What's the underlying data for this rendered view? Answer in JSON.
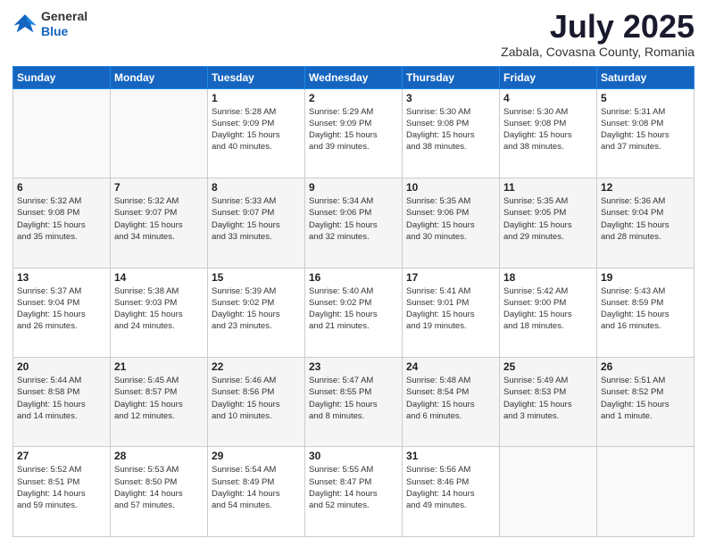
{
  "header": {
    "logo_general": "General",
    "logo_blue": "Blue",
    "month_title": "July 2025",
    "location": "Zabala, Covasna County, Romania"
  },
  "days_of_week": [
    "Sunday",
    "Monday",
    "Tuesday",
    "Wednesday",
    "Thursday",
    "Friday",
    "Saturday"
  ],
  "weeks": [
    [
      {
        "day": "",
        "info": ""
      },
      {
        "day": "",
        "info": ""
      },
      {
        "day": "1",
        "info": "Sunrise: 5:28 AM\nSunset: 9:09 PM\nDaylight: 15 hours\nand 40 minutes."
      },
      {
        "day": "2",
        "info": "Sunrise: 5:29 AM\nSunset: 9:09 PM\nDaylight: 15 hours\nand 39 minutes."
      },
      {
        "day": "3",
        "info": "Sunrise: 5:30 AM\nSunset: 9:08 PM\nDaylight: 15 hours\nand 38 minutes."
      },
      {
        "day": "4",
        "info": "Sunrise: 5:30 AM\nSunset: 9:08 PM\nDaylight: 15 hours\nand 38 minutes."
      },
      {
        "day": "5",
        "info": "Sunrise: 5:31 AM\nSunset: 9:08 PM\nDaylight: 15 hours\nand 37 minutes."
      }
    ],
    [
      {
        "day": "6",
        "info": "Sunrise: 5:32 AM\nSunset: 9:08 PM\nDaylight: 15 hours\nand 35 minutes."
      },
      {
        "day": "7",
        "info": "Sunrise: 5:32 AM\nSunset: 9:07 PM\nDaylight: 15 hours\nand 34 minutes."
      },
      {
        "day": "8",
        "info": "Sunrise: 5:33 AM\nSunset: 9:07 PM\nDaylight: 15 hours\nand 33 minutes."
      },
      {
        "day": "9",
        "info": "Sunrise: 5:34 AM\nSunset: 9:06 PM\nDaylight: 15 hours\nand 32 minutes."
      },
      {
        "day": "10",
        "info": "Sunrise: 5:35 AM\nSunset: 9:06 PM\nDaylight: 15 hours\nand 30 minutes."
      },
      {
        "day": "11",
        "info": "Sunrise: 5:35 AM\nSunset: 9:05 PM\nDaylight: 15 hours\nand 29 minutes."
      },
      {
        "day": "12",
        "info": "Sunrise: 5:36 AM\nSunset: 9:04 PM\nDaylight: 15 hours\nand 28 minutes."
      }
    ],
    [
      {
        "day": "13",
        "info": "Sunrise: 5:37 AM\nSunset: 9:04 PM\nDaylight: 15 hours\nand 26 minutes."
      },
      {
        "day": "14",
        "info": "Sunrise: 5:38 AM\nSunset: 9:03 PM\nDaylight: 15 hours\nand 24 minutes."
      },
      {
        "day": "15",
        "info": "Sunrise: 5:39 AM\nSunset: 9:02 PM\nDaylight: 15 hours\nand 23 minutes."
      },
      {
        "day": "16",
        "info": "Sunrise: 5:40 AM\nSunset: 9:02 PM\nDaylight: 15 hours\nand 21 minutes."
      },
      {
        "day": "17",
        "info": "Sunrise: 5:41 AM\nSunset: 9:01 PM\nDaylight: 15 hours\nand 19 minutes."
      },
      {
        "day": "18",
        "info": "Sunrise: 5:42 AM\nSunset: 9:00 PM\nDaylight: 15 hours\nand 18 minutes."
      },
      {
        "day": "19",
        "info": "Sunrise: 5:43 AM\nSunset: 8:59 PM\nDaylight: 15 hours\nand 16 minutes."
      }
    ],
    [
      {
        "day": "20",
        "info": "Sunrise: 5:44 AM\nSunset: 8:58 PM\nDaylight: 15 hours\nand 14 minutes."
      },
      {
        "day": "21",
        "info": "Sunrise: 5:45 AM\nSunset: 8:57 PM\nDaylight: 15 hours\nand 12 minutes."
      },
      {
        "day": "22",
        "info": "Sunrise: 5:46 AM\nSunset: 8:56 PM\nDaylight: 15 hours\nand 10 minutes."
      },
      {
        "day": "23",
        "info": "Sunrise: 5:47 AM\nSunset: 8:55 PM\nDaylight: 15 hours\nand 8 minutes."
      },
      {
        "day": "24",
        "info": "Sunrise: 5:48 AM\nSunset: 8:54 PM\nDaylight: 15 hours\nand 6 minutes."
      },
      {
        "day": "25",
        "info": "Sunrise: 5:49 AM\nSunset: 8:53 PM\nDaylight: 15 hours\nand 3 minutes."
      },
      {
        "day": "26",
        "info": "Sunrise: 5:51 AM\nSunset: 8:52 PM\nDaylight: 15 hours\nand 1 minute."
      }
    ],
    [
      {
        "day": "27",
        "info": "Sunrise: 5:52 AM\nSunset: 8:51 PM\nDaylight: 14 hours\nand 59 minutes."
      },
      {
        "day": "28",
        "info": "Sunrise: 5:53 AM\nSunset: 8:50 PM\nDaylight: 14 hours\nand 57 minutes."
      },
      {
        "day": "29",
        "info": "Sunrise: 5:54 AM\nSunset: 8:49 PM\nDaylight: 14 hours\nand 54 minutes."
      },
      {
        "day": "30",
        "info": "Sunrise: 5:55 AM\nSunset: 8:47 PM\nDaylight: 14 hours\nand 52 minutes."
      },
      {
        "day": "31",
        "info": "Sunrise: 5:56 AM\nSunset: 8:46 PM\nDaylight: 14 hours\nand 49 minutes."
      },
      {
        "day": "",
        "info": ""
      },
      {
        "day": "",
        "info": ""
      }
    ]
  ]
}
